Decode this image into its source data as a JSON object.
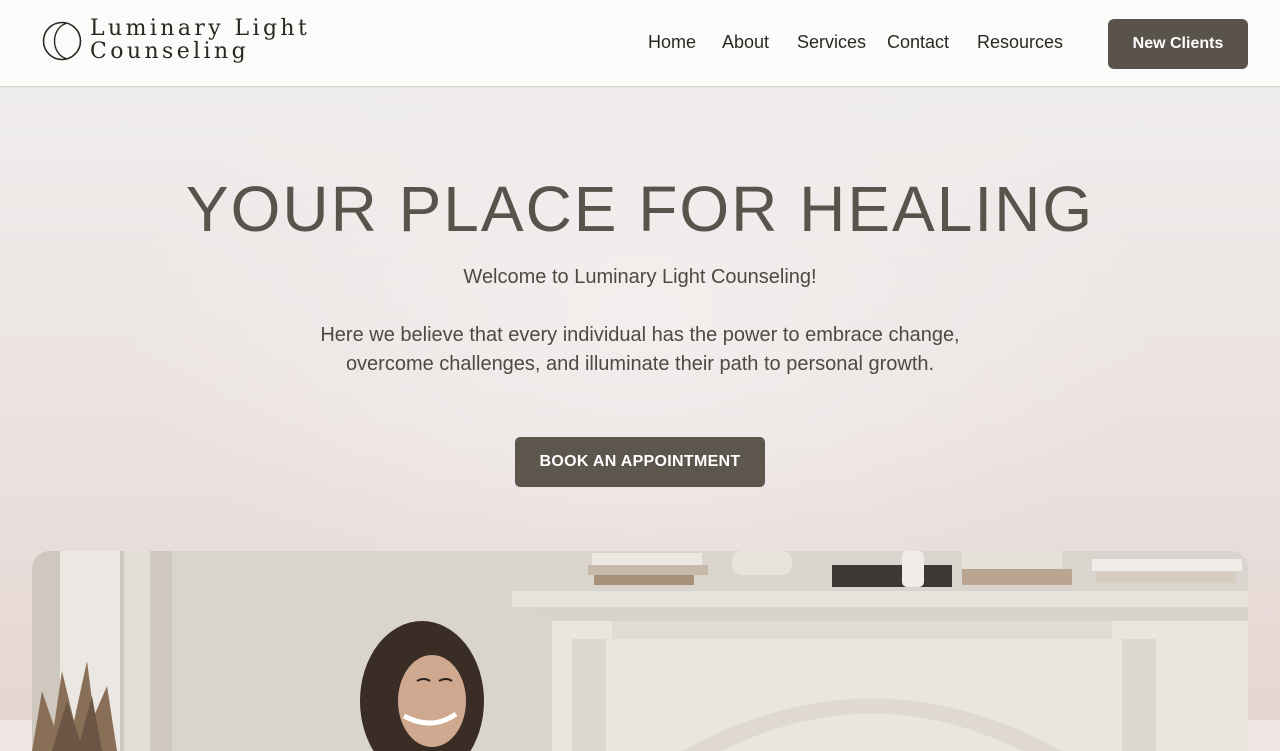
{
  "header": {
    "logo": {
      "line1": "Luminary Light",
      "line2": "Counseling",
      "icon": "crescent-moon-icon"
    },
    "nav": [
      {
        "label": "Home"
      },
      {
        "label": "About"
      },
      {
        "label": "Services"
      },
      {
        "label": "Contact"
      },
      {
        "label": "Resources"
      }
    ],
    "cta_label": "New Clients"
  },
  "hero": {
    "title": "YOUR PLACE FOR HEALING",
    "welcome": "Welcome to Luminary Light Counseling!",
    "body": "Here we believe that every individual has the power to embrace change, overcome challenges, and illuminate their path to personal growth.",
    "button_label": "BOOK AN APPOINTMENT"
  },
  "colors": {
    "primary_button": "#5a534b",
    "heading_text": "#58534b",
    "header_bg": "#fbfbfa",
    "hero_bg": "#ede6e4"
  }
}
